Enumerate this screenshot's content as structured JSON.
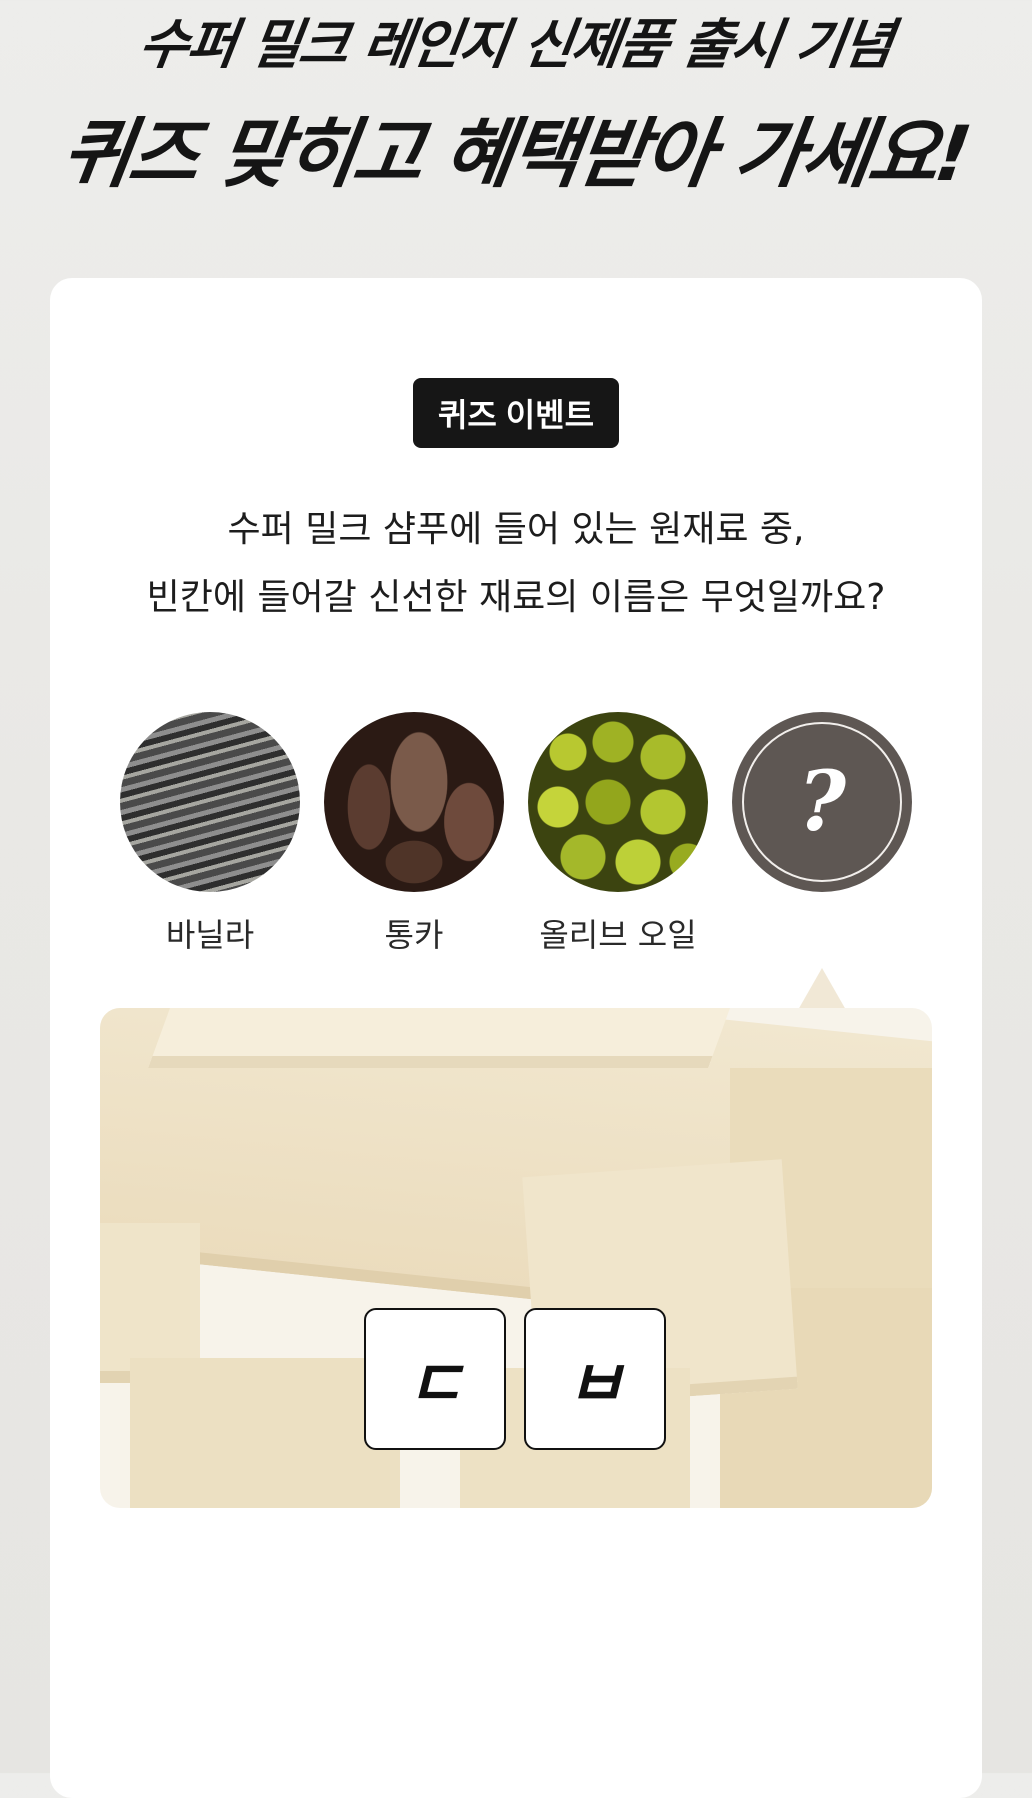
{
  "header": {
    "line1": "수퍼 밀크 레인지 신제품 출시 기념",
    "line2": "퀴즈 맞히고 혜택받아 가세요!"
  },
  "quiz": {
    "badge": "퀴즈 이벤트",
    "question_line1": "수퍼 밀크 샴푸에 들어 있는 원재료 중,",
    "question_line2": "빈칸에 들어갈 신선한 재료의 이름은 무엇일까요?",
    "ingredients": [
      {
        "label": "바닐라",
        "icon": "vanilla-image"
      },
      {
        "label": "통카",
        "icon": "tonka-image"
      },
      {
        "label": "올리브 오일",
        "icon": "olive-image"
      },
      {
        "label": "",
        "icon": "question-mark-icon"
      }
    ],
    "mystery_symbol": "?",
    "answer_hints": [
      "ㄷ",
      "ㅂ"
    ]
  },
  "colors": {
    "badge_bg": "#161616",
    "card_bg": "#ffffff",
    "page_bg": "#ebeae7"
  }
}
